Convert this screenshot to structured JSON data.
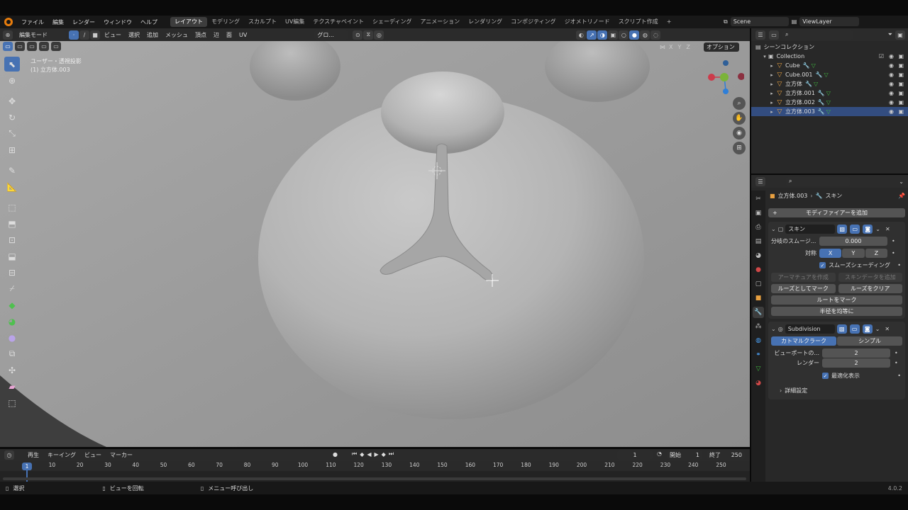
{
  "menubar": {
    "items": [
      "ファイル",
      "編集",
      "レンダー",
      "ウィンドウ",
      "ヘルプ"
    ],
    "workspaces": [
      "レイアウト",
      "モデリング",
      "スカルプト",
      "UV編集",
      "テクスチャペイント",
      "シェーディング",
      "アニメーション",
      "レンダリング",
      "コンポジティング",
      "ジオメトリノード",
      "スクリプト作成"
    ],
    "active_workspace": "レイアウト",
    "add_tab": "+",
    "scene": "Scene",
    "view_layer": "ViewLayer"
  },
  "viewport": {
    "mode": "編集モード",
    "menus": [
      "ビュー",
      "選択",
      "追加",
      "メッシュ",
      "頂点",
      "辺",
      "面",
      "UV"
    ],
    "transform_orientation": "グロ...",
    "view_label": "ユーザー・透視投影",
    "object_label": "(1) 立方体.003",
    "axis_xyz": [
      "X",
      "Y",
      "Z"
    ],
    "options": "オプション"
  },
  "outliner": {
    "root": "シーンコレクション",
    "collection": "Collection",
    "objects": [
      {
        "name": "Cube",
        "selected": false
      },
      {
        "name": "Cube.001",
        "selected": false
      },
      {
        "name": "立方体",
        "selected": false
      },
      {
        "name": "立方体.001",
        "selected": false
      },
      {
        "name": "立方体.002",
        "selected": false
      },
      {
        "name": "立方体.003",
        "selected": true
      }
    ]
  },
  "properties": {
    "breadcrumb_object": "立方体.003",
    "breadcrumb_modifier": "スキン",
    "add_modifier": "モディファイアーを追加",
    "skin": {
      "name": "スキン",
      "branch_smoothing_label": "分岐のスムージ...",
      "branch_smoothing_value": "0.000",
      "symmetry_label": "対称",
      "symmetry_axes": [
        "X",
        "Y",
        "Z"
      ],
      "smooth_shading": "スムーズシェーディング",
      "create_armature": "アーマチュアを作成",
      "add_skin_data": "スキンデータを追加",
      "mark_loose": "ルーズとしてマーク",
      "clear_loose": "ルーズをクリア",
      "mark_root": "ルートをマーク",
      "equalize_radii": "半径を均等に"
    },
    "subdivision": {
      "name": "Subdivision",
      "catmull_clark": "カトマルクラーク",
      "simple": "シンプル",
      "viewport_levels_label": "ビューポートの...",
      "viewport_levels": "2",
      "render_label": "レンダー",
      "render_levels": "2",
      "optimal_display": "最適化表示",
      "advanced": "詳細設定"
    }
  },
  "timeline": {
    "menus": [
      "再生",
      "キーイング",
      "ビュー",
      "マーカー"
    ],
    "current_frame": "1",
    "start_label": "開始",
    "start": "1",
    "end_label": "終了",
    "end": "250",
    "ticks": [
      "1",
      "10",
      "20",
      "30",
      "40",
      "50",
      "60",
      "70",
      "80",
      "90",
      "100",
      "110",
      "120",
      "130",
      "140",
      "150",
      "160",
      "170",
      "180",
      "190",
      "200",
      "210",
      "220",
      "230",
      "240",
      "250"
    ]
  },
  "statusbar": {
    "select": "選択",
    "rotate_view": "ビューを回転",
    "call_menu": "メニュー呼び出し",
    "version": "4.0.2"
  },
  "colors": {
    "accent": "#4772b3",
    "selected_row": "#334d80",
    "object_icon": "#e8a040",
    "mesh_icon": "#3fb63f",
    "viewport_bg": "#3f3f3f"
  }
}
